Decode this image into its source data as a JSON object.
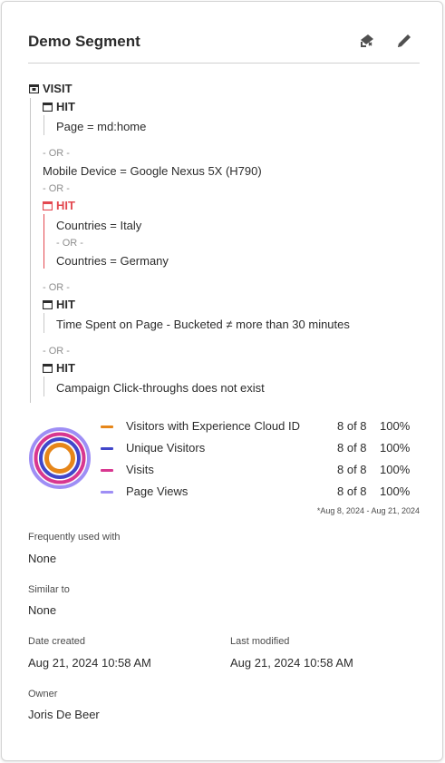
{
  "header": {
    "title": "Demo Segment"
  },
  "segment": {
    "visit_label": "VISIT",
    "hit_label": "HIT",
    "or_label": "- OR -",
    "rule_page": "Page = md:home",
    "rule_mobile": "Mobile Device = Google Nexus 5X (H790)",
    "rule_italy": "Countries = Italy",
    "rule_germany": "Countries = Germany",
    "rule_time": "Time Spent on Page - Bucketed ≠ more than 30 minutes",
    "rule_campaign": "Campaign Click-throughs does not exist"
  },
  "metrics": {
    "items": [
      {
        "name": "Visitors with Experience Cloud ID",
        "count": "8 of 8",
        "percent": "100%",
        "color": "#e68619",
        "fraction": 1.0
      },
      {
        "name": "Unique Visitors",
        "count": "8 of 8",
        "percent": "100%",
        "color": "#4046ca",
        "fraction": 1.0
      },
      {
        "name": "Visits",
        "count": "8 of 8",
        "percent": "100%",
        "color": "#d83790",
        "fraction": 1.0
      },
      {
        "name": "Page Views",
        "count": "8 of 8",
        "percent": "100%",
        "color": "#9e8ef5",
        "fraction": 1.0
      }
    ],
    "date_range": "*Aug 8, 2024 - Aug 21, 2024"
  },
  "details": {
    "frequently_used_label": "Frequently used with",
    "frequently_used_value": "None",
    "similar_label": "Similar to",
    "similar_value": "None",
    "created_label": "Date created",
    "created_value": "Aug 21, 2024 10:58 AM",
    "modified_label": "Last modified",
    "modified_value": "Aug 21, 2024 10:58 AM",
    "owner_label": "Owner",
    "owner_value": "Joris De Beer"
  },
  "colors": {
    "accent_red": "#e34850",
    "divider": "#d0d0d0"
  },
  "icons": [
    "share-icon",
    "edit-icon",
    "visit-container-icon",
    "hit-container-icon"
  ]
}
